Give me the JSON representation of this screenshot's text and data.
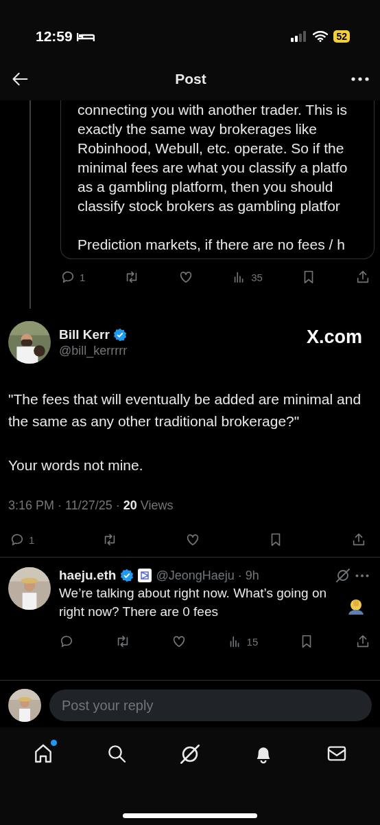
{
  "status_bar": {
    "time": "12:59",
    "battery": "52"
  },
  "header": {
    "title": "Post"
  },
  "quoted": {
    "paragraphs": [
      [
        "connecting you with another trader. This is",
        "exactly the same way brokerages like",
        "Robinhood, Webull, etc. operate. So if the",
        "minimal fees are what you classify a platfo",
        "as a gambling platform, then you should",
        "classify stock brokers as gambling platfor"
      ],
      [
        "Prediction markets, if there are no fees / h"
      ]
    ],
    "actions": {
      "replies": "1",
      "views": "35"
    }
  },
  "post": {
    "name": "Bill Kerr",
    "verified": true,
    "handle": "@bill_kerrrrr",
    "source": "X.com",
    "paragraphs": [
      "\"The fees that will eventually be added are minimal and the same as any other traditional brokerage?\"",
      "Your words not mine."
    ],
    "meta": "3:16 PM · 11/27/25 · **20** Views",
    "replies": "1"
  },
  "reply": {
    "name": "haeju.eth",
    "verified": true,
    "affiliate": true,
    "handle": "@JeongHaeju · 9h",
    "text": "We’re talking about right now. What’s going on right now? There are 0 fees",
    "views": "15"
  },
  "composer": {
    "placeholder": "Post your reply"
  },
  "tabs": [
    {
      "kind": "home",
      "dot": true
    },
    {
      "kind": "search",
      "dot": false
    },
    {
      "kind": "grok",
      "dot": false
    },
    {
      "kind": "notifications",
      "dot": false
    },
    {
      "kind": "messages",
      "dot": false
    }
  ]
}
